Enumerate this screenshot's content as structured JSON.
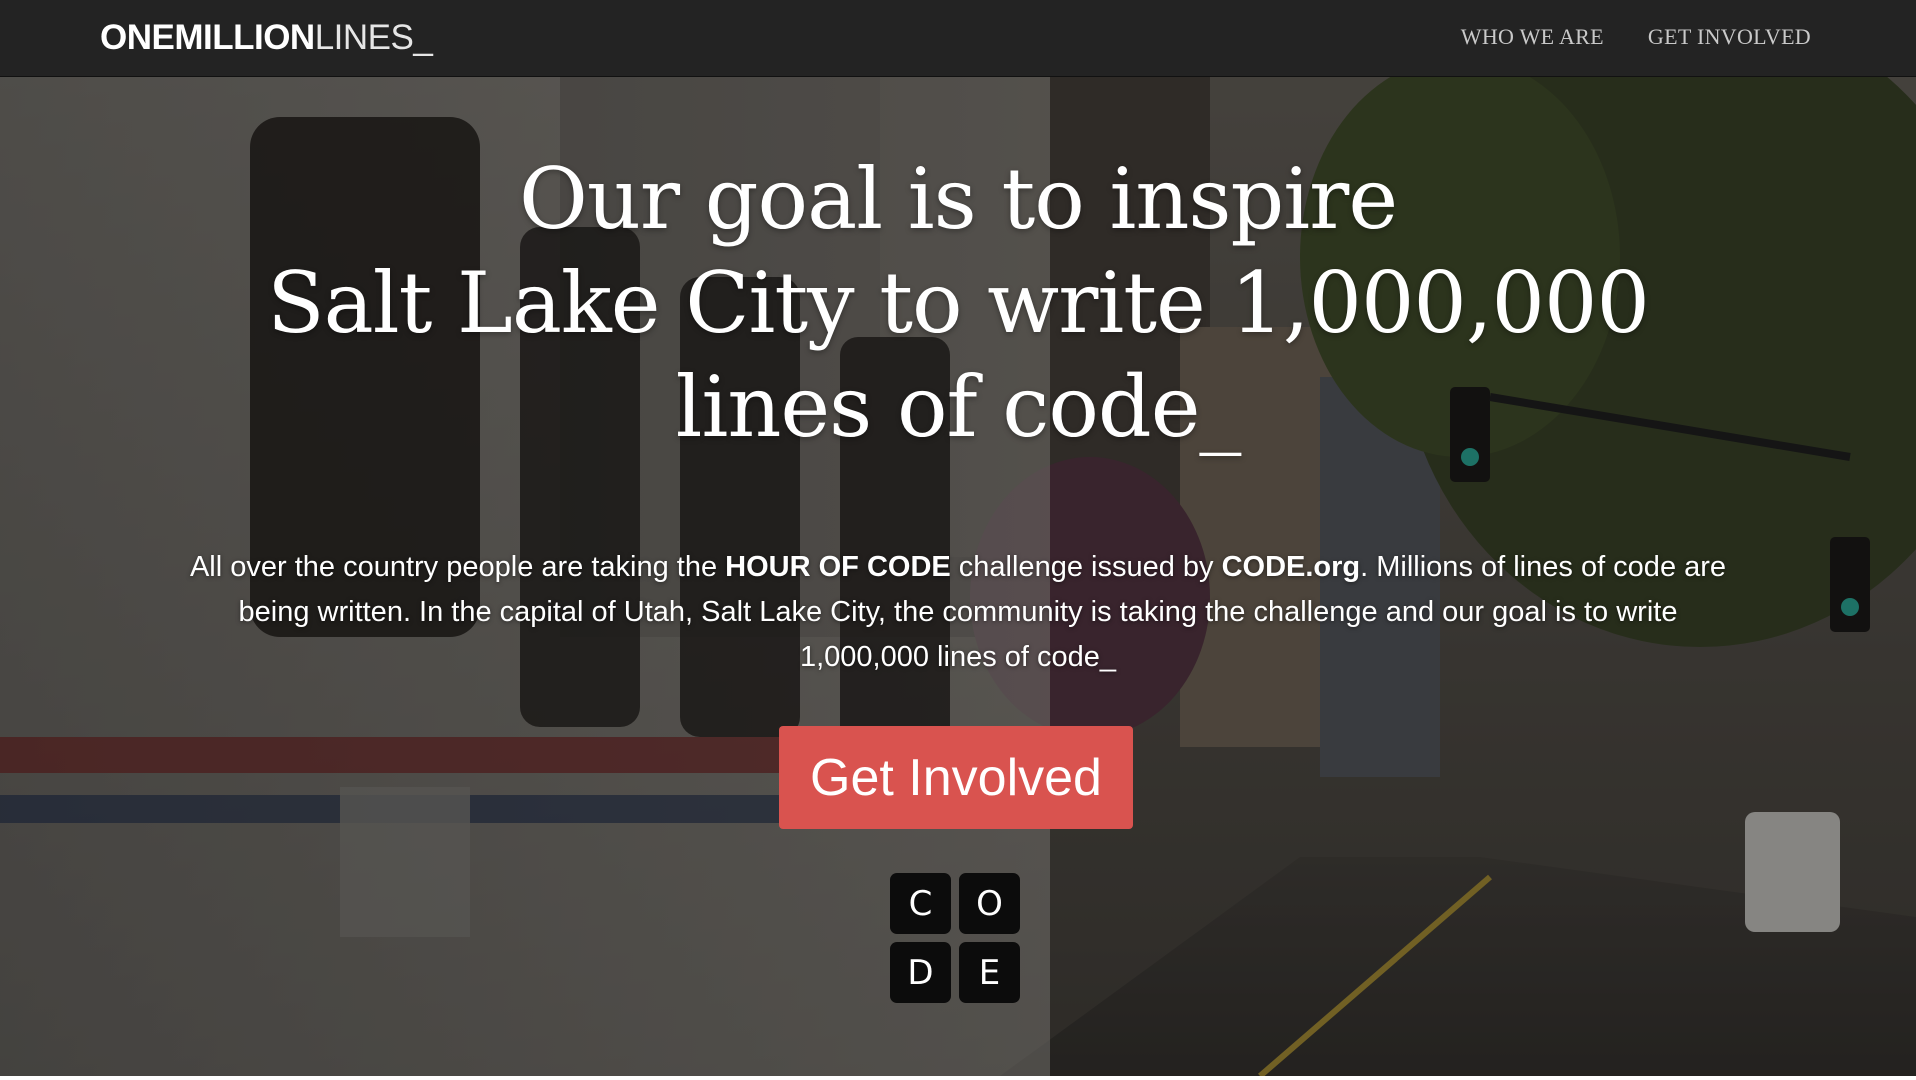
{
  "nav": {
    "brand_bold": "ONEMILLION",
    "brand_light": "LINES_",
    "links": [
      "WHO WE ARE",
      "GET INVOLVED"
    ]
  },
  "hero": {
    "headline": [
      "Our goal is to inspire",
      "Salt Lake City to write 1,000,000",
      "lines of code_"
    ],
    "intro": {
      "t1": "All over the country people are taking the ",
      "b1": "HOUR OF CODE",
      "t2": " challenge issued by ",
      "b2": "CODE.org",
      "t3": ". Millions of lines of code are being written. In the capital of Utah, Salt Lake City, the community is taking the challenge and our goal is to write 1,000,000 lines of code_"
    },
    "cta_label": "Get Involved",
    "code_logo": [
      "C",
      "O",
      "D",
      "E"
    ]
  },
  "colors": {
    "navbar": "#232323",
    "cta": "#d9534f",
    "text": "#ffffff"
  }
}
